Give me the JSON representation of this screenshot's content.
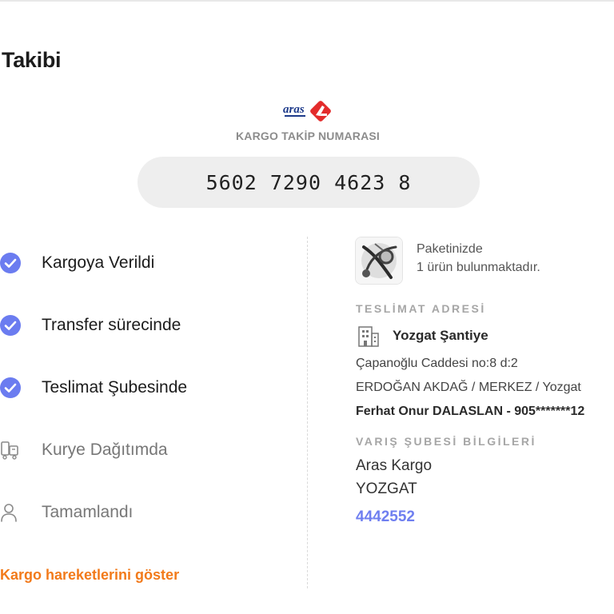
{
  "page": {
    "title": "Takibi"
  },
  "shipment": {
    "carrier_logo": "aras-kargo-logo",
    "carrier_logo_text": "aras",
    "tracking_caption": "KARGO TAKİP NUMARASI",
    "tracking_number": "5602 7290 4623 8"
  },
  "colors": {
    "accent_done": "#6b7cf0",
    "link_orange": "#f27a1a",
    "phone_link": "#6f7ff0"
  },
  "steps": [
    {
      "label": "Kargoya Verildi",
      "status": "done",
      "icon": "check-circle-icon"
    },
    {
      "label": "Transfer sürecinde",
      "status": "done",
      "icon": "check-circle-icon"
    },
    {
      "label": "Teslimat Şubesinde",
      "status": "done",
      "icon": "check-circle-icon"
    },
    {
      "label": "Kurye Dağıtımda",
      "status": "pending",
      "icon": "courier-icon"
    },
    {
      "label": "Tamamlandı",
      "status": "pending",
      "icon": "person-icon"
    }
  ],
  "actions": {
    "show_moves": "Kargo hareketlerini göster"
  },
  "package": {
    "line1": "Paketinizde",
    "line2": "1 ürün bulunmaktadır."
  },
  "delivery_address": {
    "heading": "TESLİMAT ADRESİ",
    "name": "Yozgat Şantiye",
    "street": "Çapanoğlu Caddesi no:8 d:2",
    "district": "ERDOĞAN AKDAĞ / MERKEZ / Yozgat",
    "contact": "Ferhat Onur DALASLAN - 905*******12"
  },
  "branch": {
    "heading": "VARIŞ ŞUBESİ BİLGİLERİ",
    "company": "Aras Kargo",
    "city": "YOZGAT",
    "phone": "4442552"
  }
}
